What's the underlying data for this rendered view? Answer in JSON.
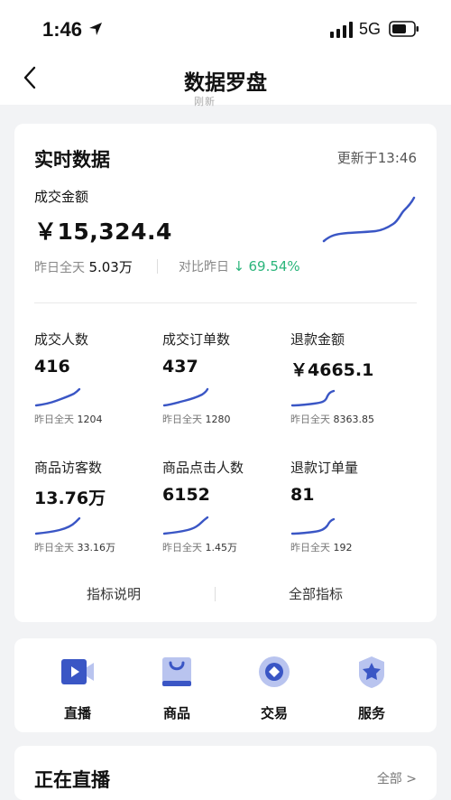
{
  "status_bar": {
    "time": "1:46",
    "network": "5G"
  },
  "nav": {
    "title": "数据罗盘"
  },
  "peek_text": "刚新",
  "realtime": {
    "title": "实时数据",
    "update_time": "更新于13:46",
    "gmv": {
      "label": "成交金额",
      "value": "￥15,324.4",
      "yesterday_label": "昨日全天",
      "yesterday_value": "5.03万",
      "compare_label": "对比昨日",
      "compare_value": "69.54%",
      "compare_direction": "down"
    },
    "metrics": [
      {
        "label": "成交人数",
        "value": "416",
        "yesterday_label": "昨日全天",
        "yesterday_value": "1204"
      },
      {
        "label": "成交订单数",
        "value": "437",
        "yesterday_label": "昨日全天",
        "yesterday_value": "1280"
      },
      {
        "label": "退款金额",
        "value": "￥4665.1",
        "yesterday_label": "昨日全天",
        "yesterday_value": "8363.85"
      },
      {
        "label": "商品访客数",
        "value": "13.76万",
        "yesterday_label": "昨日全天",
        "yesterday_value": "33.16万"
      },
      {
        "label": "商品点击人数",
        "value": "6152",
        "yesterday_label": "昨日全天",
        "yesterday_value": "1.45万"
      },
      {
        "label": "退款订单量",
        "value": "81",
        "yesterday_label": "昨日全天",
        "yesterday_value": "192"
      }
    ],
    "links": {
      "left": "指标说明",
      "right": "全部指标"
    }
  },
  "quick_nav": [
    {
      "label": "直播",
      "icon": "video-icon"
    },
    {
      "label": "商品",
      "icon": "bag-icon"
    },
    {
      "label": "交易",
      "icon": "transaction-icon"
    },
    {
      "label": "服务",
      "icon": "service-badge-icon"
    }
  ],
  "live": {
    "title": "正在直播",
    "all_label": "全部 >"
  },
  "colors": {
    "accent": "#3a56c5",
    "green": "#2bb57b",
    "background": "#f2f3f5"
  }
}
